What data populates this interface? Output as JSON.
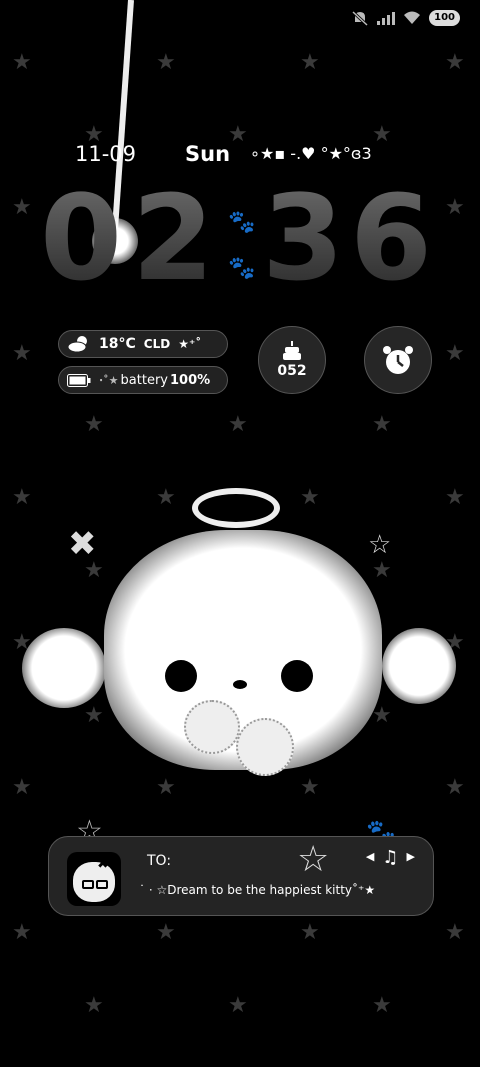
{
  "status_bar": {
    "icons": [
      "mute-icon",
      "signal-icon",
      "wifi-icon"
    ],
    "battery_label": "100"
  },
  "date_row": {
    "date": "11-09",
    "weekday": "Sun",
    "decoration": "∘★▪ -.♥ °★°ɞ3"
  },
  "clock": {
    "hour1": "0",
    "hour2": "2",
    "minute1": "3",
    "minute2": "6",
    "separator_icon": "paw-icon"
  },
  "widgets": {
    "weather": {
      "icon": "partly-cloudy-icon",
      "temp": "18°C",
      "condition": "CLD",
      "deco": "★⁺˚"
    },
    "battery": {
      "icon": "battery-icon",
      "deco": "⋅˚★",
      "label": "battery",
      "percent": "100%"
    },
    "steps": {
      "icon": "cake-icon",
      "value": "052"
    },
    "alarm": {
      "icon": "alarm-clock-icon"
    }
  },
  "music": {
    "to_label": "TO:",
    "message": "˙ ⋅ ☆Dream to be the happiest kitty˚⁺★",
    "controls": {
      "prev": "◀",
      "note": "♫",
      "next": "▶"
    }
  },
  "colors": {
    "background": "#000000",
    "card": "#242424",
    "accent": "#ffffff"
  }
}
